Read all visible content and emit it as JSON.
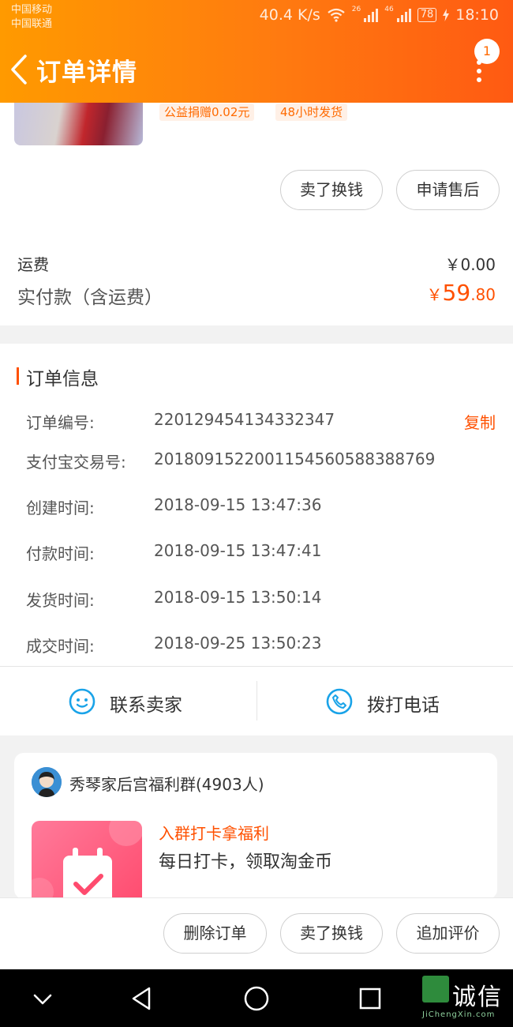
{
  "status_bar": {
    "carrier_1": "中国移动",
    "carrier_2": "中国联通",
    "speed": "40.4 K/s",
    "net_1": "26",
    "net_2": "46",
    "battery": "78",
    "time": "18:10"
  },
  "header": {
    "title": "订单详情",
    "badge": "1",
    "accent": "#ff5000"
  },
  "product": {
    "tags": [
      "公益捐赠0.02元",
      "48小时发货"
    ],
    "buttons": [
      "卖了换钱",
      "申请售后"
    ]
  },
  "fees": {
    "shipping_label": "运费",
    "shipping_value": "￥0.00",
    "paid_label": "实付款（含运费）",
    "paid_currency": "￥",
    "paid_int": "59",
    "paid_dec": ".80"
  },
  "order_info": {
    "title": "订单信息",
    "copy": "复制",
    "rows": [
      {
        "label": "订单编号:",
        "value": "220129454134332347"
      },
      {
        "label": "支付宝交易号:",
        "value": "2018091522001154560588388769"
      },
      {
        "label": "创建时间:",
        "value": "2018-09-15 13:47:36"
      },
      {
        "label": "付款时间:",
        "value": "2018-09-15 13:47:41"
      },
      {
        "label": "发货时间:",
        "value": "2018-09-15 13:50:14"
      },
      {
        "label": "成交时间:",
        "value": "2018-09-25 13:50:23"
      }
    ]
  },
  "contact": {
    "seller": "联系卖家",
    "phone": "拨打电话"
  },
  "group": {
    "name": "秀琴家后宫福利群(4903人)",
    "promo_title": "入群打卡拿福利",
    "promo_desc": "每日打卡，领取淘金币"
  },
  "bottom_actions": [
    "删除订单",
    "卖了换钱",
    "追加评价"
  ],
  "watermark": {
    "text": "诚信",
    "sub": "JiChengXin.com"
  }
}
